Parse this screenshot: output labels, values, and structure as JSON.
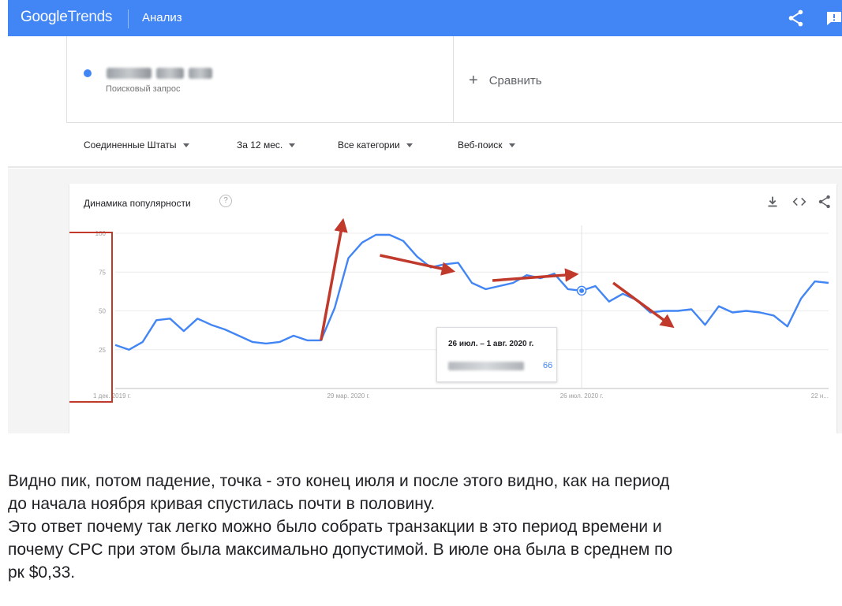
{
  "header": {
    "logo_google": "Google",
    "logo_trends": "Trends",
    "title": "Анализ",
    "share_icon": "share-icon",
    "feedback_icon": "feedback-icon"
  },
  "search_term": {
    "label": "Поисковый запрос",
    "color": "#4285f4"
  },
  "compare": {
    "plus": "+",
    "label": "Сравнить"
  },
  "filters": [
    {
      "label": "Соединенные Штаты"
    },
    {
      "label": "За 12 мес."
    },
    {
      "label": "Все категории"
    },
    {
      "label": "Веб-поиск"
    }
  ],
  "card": {
    "title": "Динамика популярности",
    "help_icon": "?",
    "download_icon": "download-icon",
    "embed_icon": "embed-icon",
    "share_icon": "share-icon"
  },
  "chart_data": {
    "type": "line",
    "title": "",
    "xlabel": "",
    "ylabel": "",
    "ylim": [
      0,
      100
    ],
    "y_ticks": [
      25,
      50,
      75,
      100
    ],
    "y_tick_labels": [
      "25",
      "50",
      "75",
      "100"
    ],
    "x_tick_labels": [
      "1 дек. 2019 г.",
      "29 мар. 2020 г.",
      "26 июл. 2020 г.",
      "22 н..."
    ],
    "x_tick_weeks": [
      0,
      17,
      34,
      51
    ],
    "grid": true,
    "line_color": "#4285f4",
    "annotation_color": "#c0392b",
    "series": [
      {
        "values": [
          28,
          25,
          30,
          44,
          45,
          37,
          45,
          41,
          38,
          34,
          30,
          29,
          30,
          34,
          31,
          31,
          52,
          84,
          94,
          99,
          99,
          95,
          85,
          78,
          80,
          81,
          68,
          64,
          66,
          68,
          73,
          71,
          74,
          64,
          63,
          66,
          56,
          61,
          57,
          49,
          50,
          50,
          51,
          41,
          53,
          49,
          50,
          49,
          47,
          40,
          58,
          69,
          68
        ]
      }
    ],
    "highlight": {
      "week": 34,
      "value": 66
    }
  },
  "tooltip": {
    "date": "26 июл. – 1 авг. 2020 г.",
    "value": "66"
  },
  "caption": {
    "line1": "Видно пик, потом падение, точка - это конец июля и после этого видно, как на период",
    "line2": "до начала ноября кривая спустилась почти в половину.",
    "line3": "Это ответ почему так легко можно было собрать транзакции в это период времени и",
    "line4": "почему CPC при этом была максимально допустимой. В июле она была в среднем по",
    "line5": "рк $0,33."
  }
}
